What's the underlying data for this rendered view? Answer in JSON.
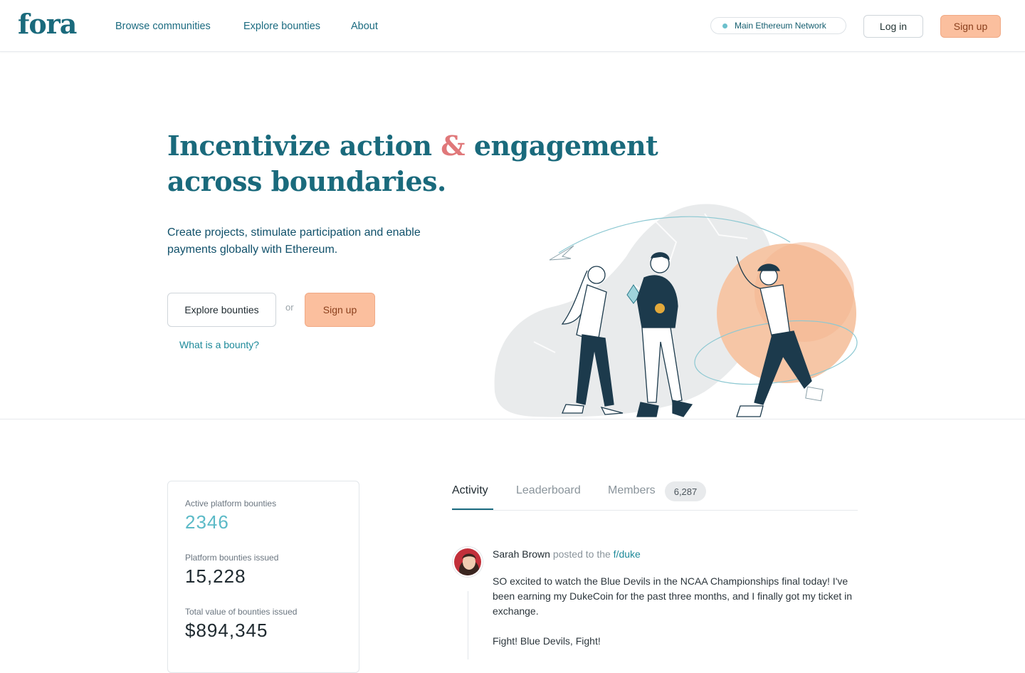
{
  "header": {
    "logo": "fora",
    "nav": [
      "Browse communities",
      "Explore bounties",
      "About"
    ],
    "network": "Main Ethereum Network",
    "login_label": "Log in",
    "signup_label": "Sign up"
  },
  "hero": {
    "title_part1": "Incentivize action ",
    "title_amp": "&",
    "title_part2": " engagement across boundaries.",
    "subtitle": "Create projects, stimulate participation and enable payments globally with Ethereum.",
    "explore_label": "Explore bounties",
    "or_text": "or",
    "signup_label": "Sign up",
    "what_link": "What is a bounty?"
  },
  "stats": {
    "active_label": "Active platform bounties",
    "active_value": "2346",
    "issued_label": "Platform bounties issued",
    "issued_value": "15,228",
    "total_label": "Total value of bounties issued",
    "total_value": "$894,345"
  },
  "tabs": {
    "activity": "Activity",
    "leaderboard": "Leaderboard",
    "members": "Members",
    "members_count": "6,287"
  },
  "post": {
    "author": "Sarah Brown",
    "action": "posted to the",
    "community": "f/duke",
    "body_p1": "SO excited to watch the Blue Devils in the NCAA Championships final today! I've been earning my DukeCoin for the past three months, and I finally got my ticket in exchange.",
    "body_p2": "Fight! Blue Devils, Fight!"
  },
  "colors": {
    "brand": "#1a6a7c",
    "accent_amp": "#e0787a",
    "signup_bg": "#fbbf9e",
    "stat_accent": "#5cbac7"
  }
}
